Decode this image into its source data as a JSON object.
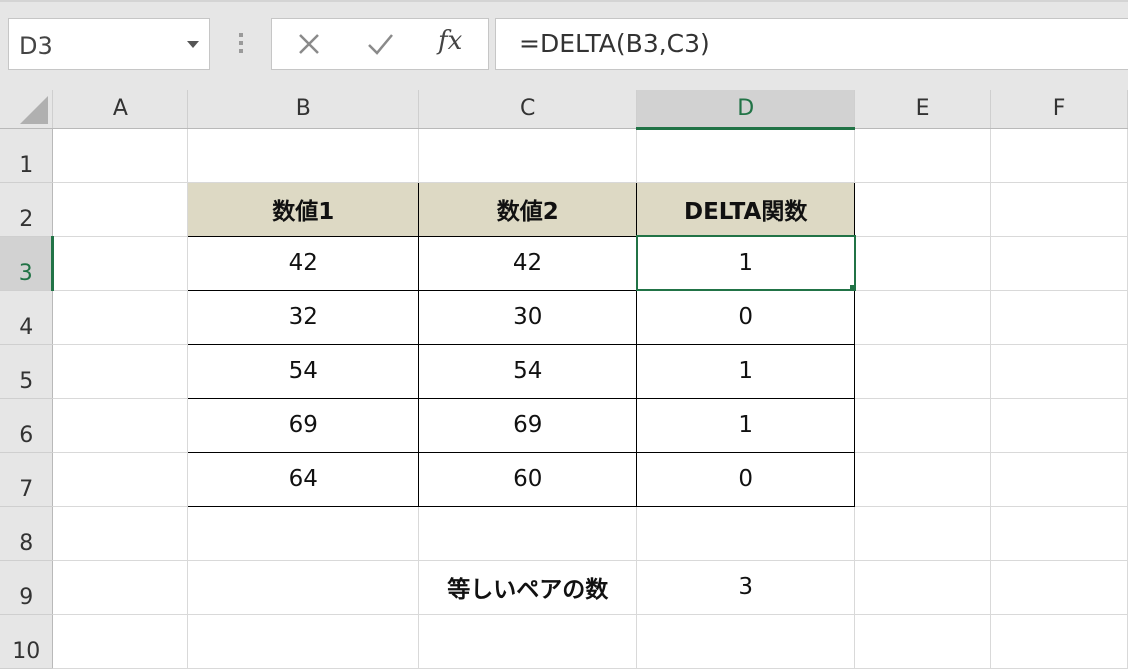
{
  "name_box": {
    "value": "D3"
  },
  "formula_bar": {
    "fx_label": "fx",
    "formula": "=DELTA(B3,C3)"
  },
  "columns": [
    "A",
    "B",
    "C",
    "D",
    "E",
    "F"
  ],
  "rows": [
    "1",
    "2",
    "3",
    "4",
    "5",
    "6",
    "7",
    "8",
    "9",
    "10"
  ],
  "table": {
    "headers": [
      "数値1",
      "数値2",
      "DELTA関数"
    ],
    "data": [
      [
        "42",
        "42",
        "1"
      ],
      [
        "32",
        "30",
        "0"
      ],
      [
        "54",
        "54",
        "1"
      ],
      [
        "69",
        "69",
        "1"
      ],
      [
        "64",
        "60",
        "0"
      ]
    ]
  },
  "summary": {
    "label": "等しいペアの数",
    "value": "3"
  },
  "colors": {
    "accent": "#217346",
    "header_fill": "#ddd9c4"
  },
  "icons": [
    "dropdown-arrow-icon",
    "more-options-icon",
    "cancel-icon",
    "enter-icon",
    "insert-function-icon",
    "select-all-icon"
  ]
}
